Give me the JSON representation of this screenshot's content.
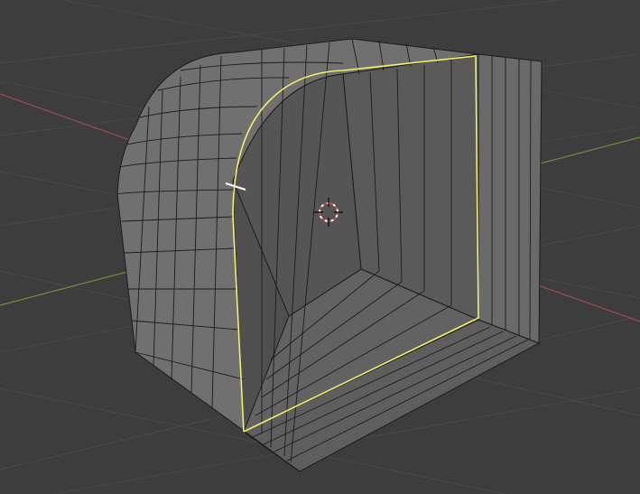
{
  "viewport": {
    "background": "#3d3d3d",
    "grid_color": "#4a4a4a",
    "x_axis_color": "#9b4a4f",
    "y_axis_color": "#6b8f3a"
  },
  "mesh": {
    "face_color": "#6e6e6e",
    "face_shade_color": "#5c5c5c",
    "inner_color": "#606060",
    "wire_color": "#1c1c1c",
    "selected_loop_color": "#f0f06a",
    "active_edge_color": "#ffffff"
  },
  "cursor_3d": {
    "icon": "3d-cursor-icon",
    "ring_colors": [
      "#e04040",
      "#ffffff"
    ],
    "crosshair_color": "#111111"
  }
}
